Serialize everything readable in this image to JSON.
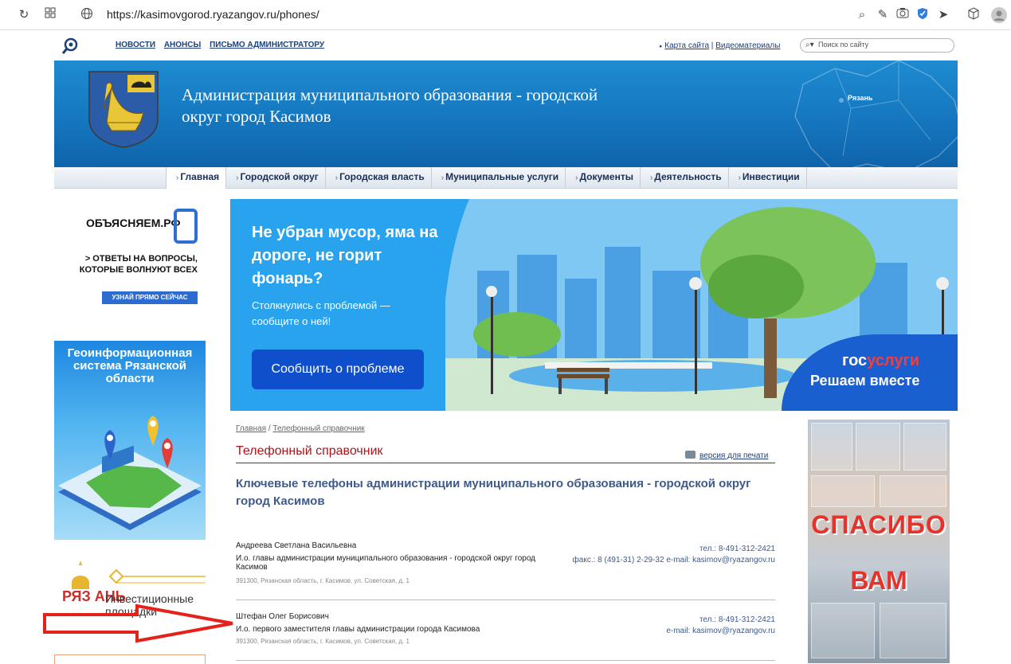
{
  "browser": {
    "url": "https://kasimovgorod.ryazangov.ru/phones/"
  },
  "topbar": {
    "links": [
      "НОВОСТИ",
      "АНОНСЫ",
      "ПИСЬМО АДМИНИСТРАТОРУ"
    ],
    "sitemap": "Карта сайта",
    "sep": "|",
    "video": "Видеоматериалы",
    "search_placeholder": "Поиск по сайту"
  },
  "header": {
    "title": "Администрация муниципального образования - городской округ город Касимов",
    "map_label": "Рязань"
  },
  "nav": {
    "items": [
      "Главная",
      "Городской округ",
      "Городская власть",
      "Муниципальные услуги",
      "Документы",
      "Деятельность",
      "Инвестиции"
    ]
  },
  "left_banners": {
    "b1_title": "ОБЪЯСНЯЕМ.РФ",
    "b1_text": "> ОТВЕТЫ НА ВОПРОСЫ, КОТОРЫЕ ВОЛНУЮТ ВСЕХ",
    "b1_button": "УЗНАЙ ПРЯМО СЕЙЧАС",
    "b2_title": "Геоинформационная система Рязанской области",
    "b3_logo": "РЯЗ АНЬ",
    "b3_text": "Инвестиционные площадки"
  },
  "promo": {
    "title": "Не убран мусор, яма на дороге, не горит фонарь?",
    "subtitle": "Столкнулись с проблемой — сообщите о ней!",
    "button": "Сообщить о проблеме",
    "gos_a": "гос",
    "gos_b": "услуги",
    "gos_slogan": "Решаем вместе"
  },
  "content": {
    "breadcrumb_home": "Главная",
    "breadcrumb_sep": " / ",
    "breadcrumb_current": "Телефонный справочник",
    "page_title": "Телефонный справочник",
    "print_link": "версия для печати",
    "heading": "Ключевые телефоны администрации муниципального образования - городской округ город Касимов",
    "entries": [
      {
        "name": "Андреева Светлана Васильевна",
        "position": "И.о. главы администрации муниципального образования - городской округ город Касимов",
        "address": "391300, Рязанская область, г. Касимов, ул. Советская, д. 1",
        "phone": "тел.: 8-491-312-2421",
        "contacts": "факс.: 8 (491-31) 2-29-32 e-mail: kasimov@ryazangov.ru"
      },
      {
        "name": "Штефан Олег Борисович",
        "position": "И.о. первого заместителя главы администрации города Касимова",
        "address": "391300, Рязанская область, г. Касимов, ул. Советская, д. 1",
        "phone": "тел.: 8-491-312-2421",
        "contacts": "e-mail: kasimov@ryazangov.ru"
      }
    ]
  },
  "right_banner": {
    "word1": "СПАСИБО",
    "word2": "ВАМ"
  },
  "colors": {
    "header_blue": "#1577bf",
    "title_red": "#a8161b",
    "link_blue": "#3d5a8a",
    "promo_blue": "#2aa3ef",
    "button_blue": "#0f4fcc",
    "arrow_red": "#e3221b"
  }
}
